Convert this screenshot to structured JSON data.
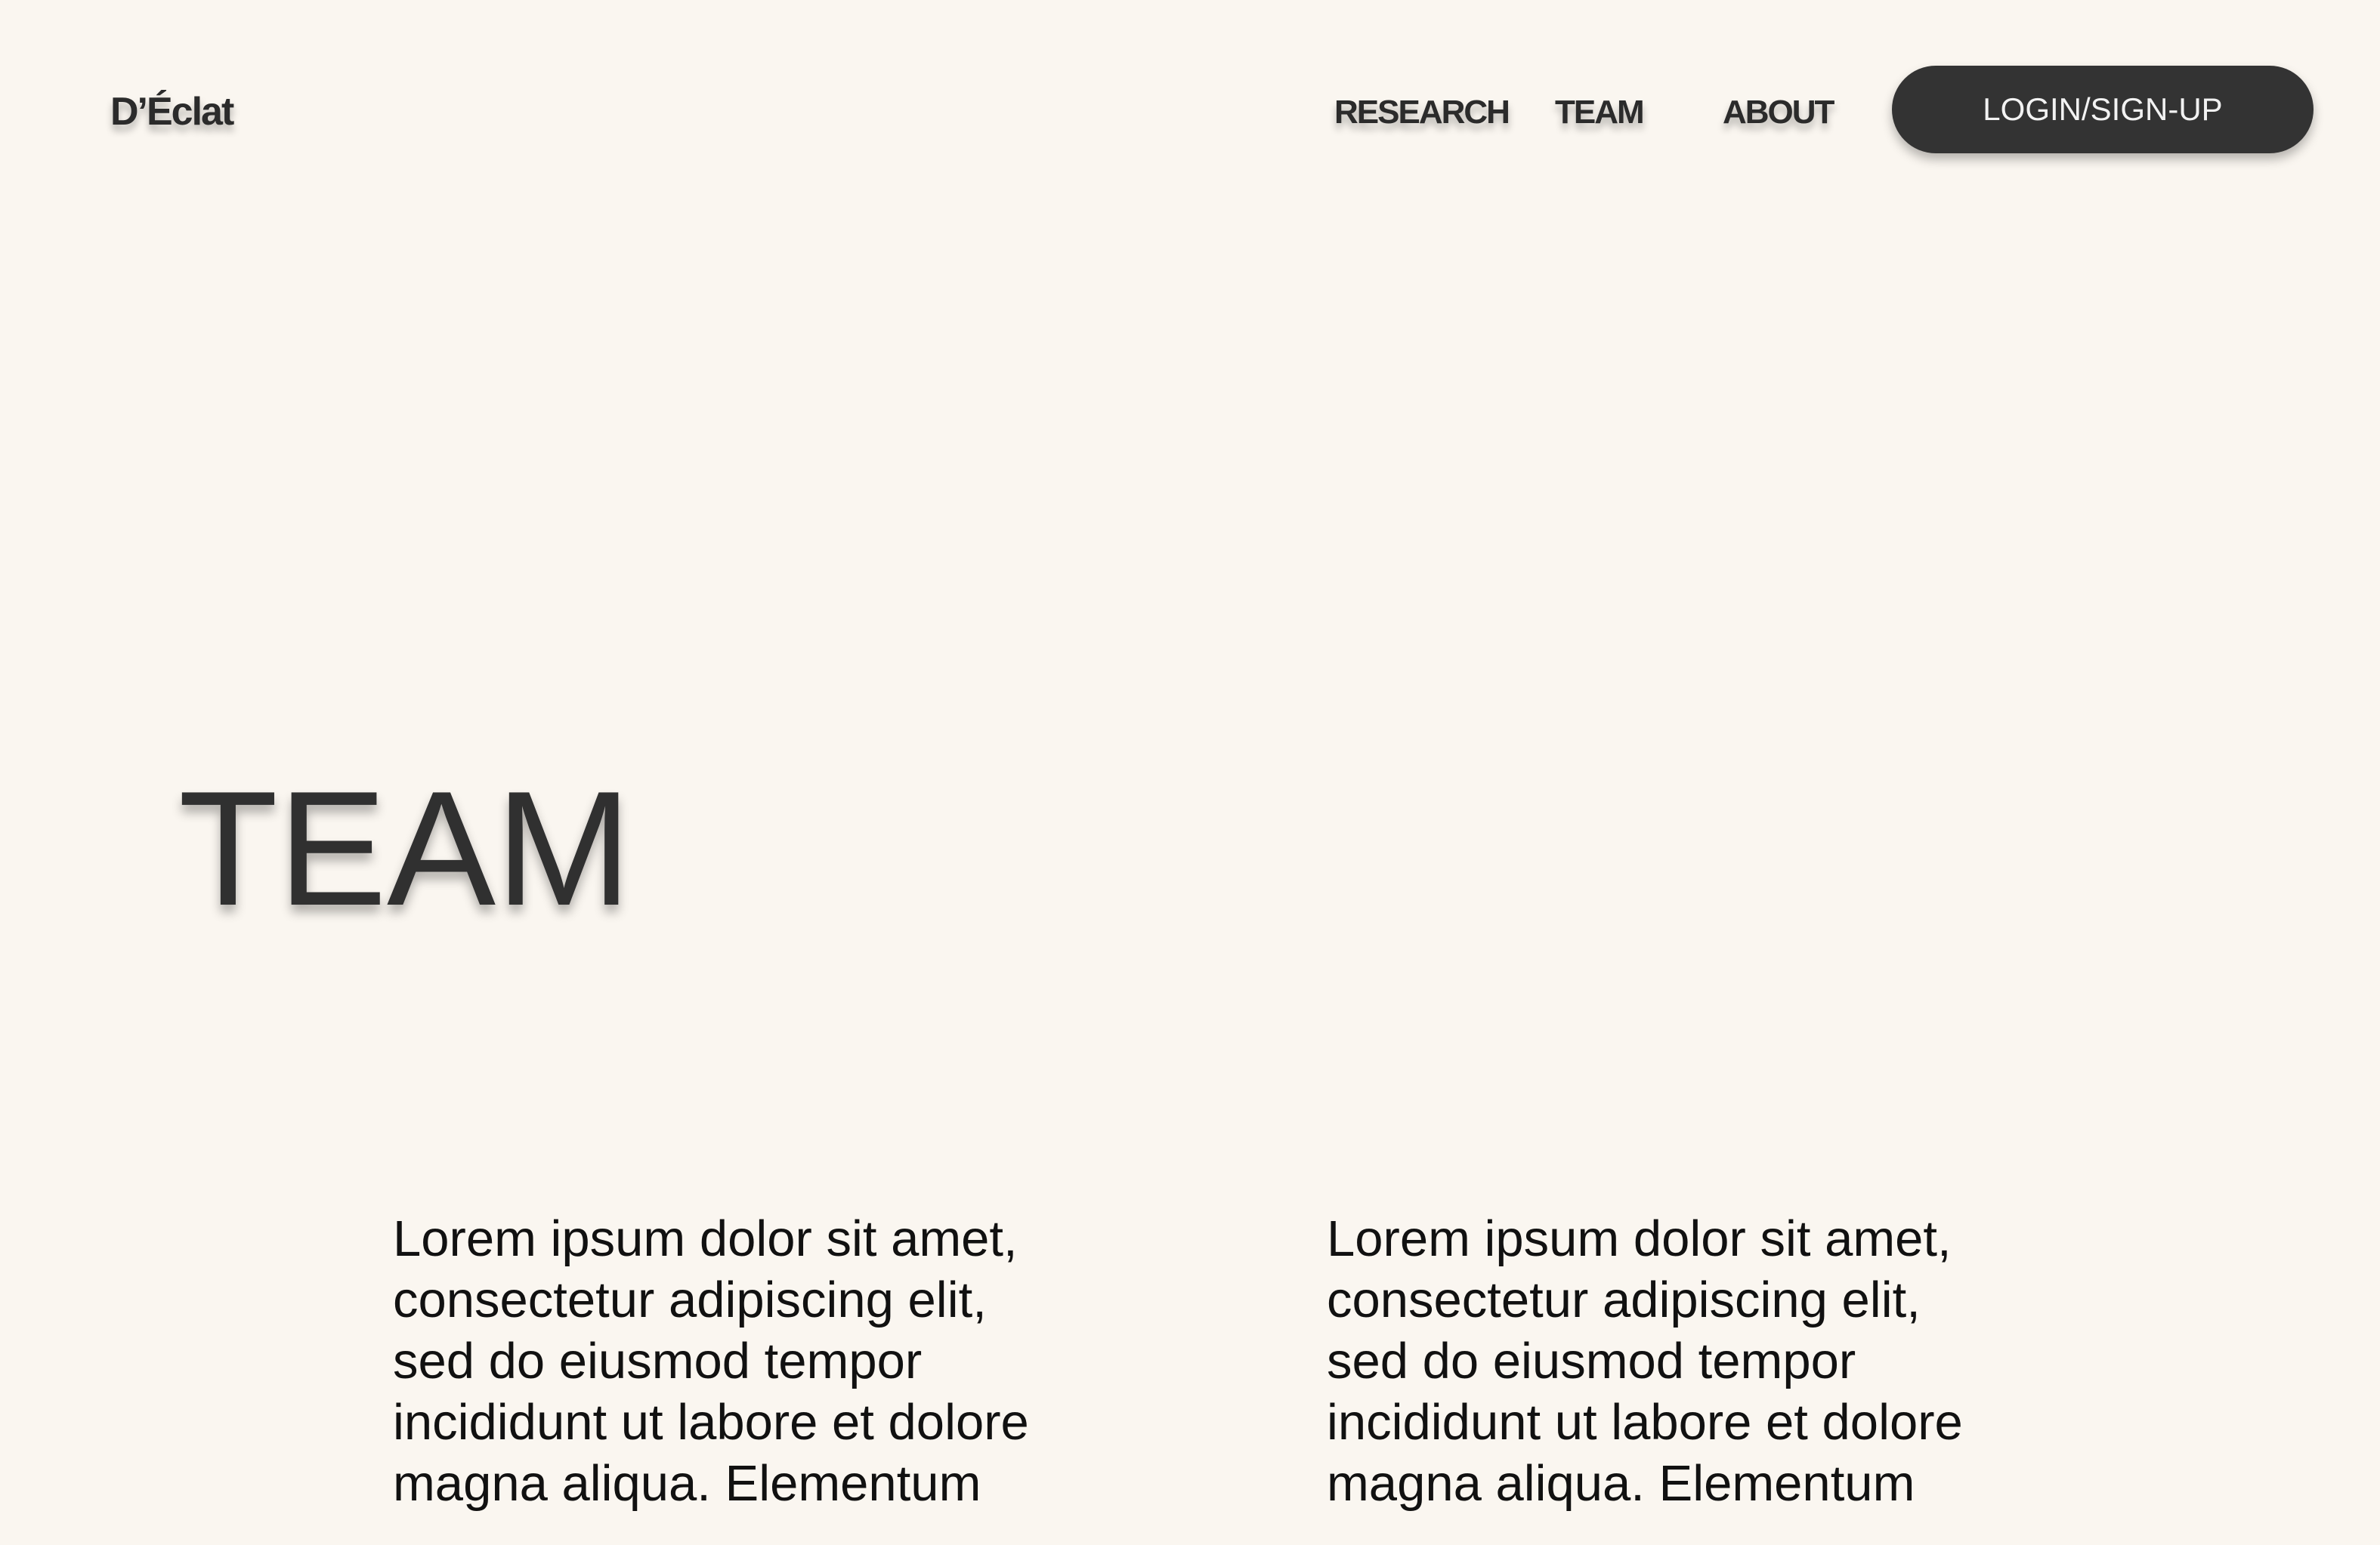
{
  "header": {
    "logo": "D’Éclat",
    "nav": {
      "research": "RESEARCH",
      "team": "TEAM",
      "about": "ABOUT"
    },
    "login_label": "LOGIN/SIGN-UP"
  },
  "hero": {
    "title": "TEAM"
  },
  "members": [
    {
      "bio": "Lorem ipsum dolor sit amet, consectetur adipiscing elit, sed do eiusmod tempor incididunt ut labore et dolore magna aliqua. Elementum"
    },
    {
      "bio": "Lorem ipsum dolor sit amet, consectetur adipiscing elit, sed do eiusmod tempor incididunt ut labore et dolore magna aliqua. Elementum"
    }
  ],
  "colors": {
    "background": "#faf6f0",
    "button": "#333333",
    "text": "#2f2f2f"
  }
}
